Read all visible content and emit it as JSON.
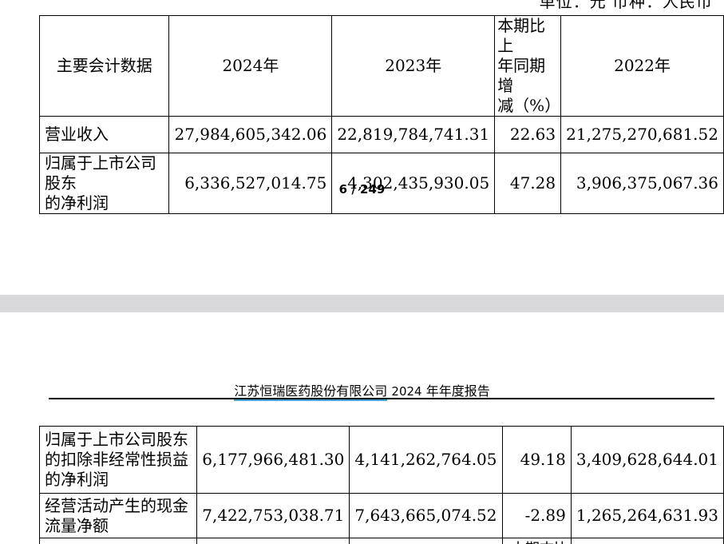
{
  "unit_line": "单位：元  币种：人民币",
  "page_number": "6 / 249",
  "report_header": {
    "company": "江苏恒瑞医药股份有限公司",
    "year": "2024",
    "title": "年年度报告"
  },
  "table": {
    "headers": [
      "主要会计数据",
      "2024年",
      "2023年",
      "本期比上年同期增减（%）",
      "2022年"
    ],
    "header_change_lines": [
      "本期比上",
      "年同期增",
      "减（%）"
    ],
    "rows_top": [
      {
        "label_lines": [
          "营业收入"
        ],
        "v2024": "27,984,605,342.06",
        "v2023": "22,819,784,741.31",
        "change": "22.63",
        "v2022": "21,275,270,681.52"
      },
      {
        "label_lines": [
          "归属于上市公司股东",
          "的净利润"
        ],
        "v2024": "6,336,527,014.75",
        "v2023": "4,302,435,930.05",
        "change": "47.28",
        "v2022": "3,906,375,067.36"
      }
    ],
    "rows_bottom": [
      {
        "label_lines": [
          "归属于上市公司股东",
          "的扣除非经常性损益",
          "的净利润"
        ],
        "v2024": "6,177,966,481.30",
        "v2023": "4,141,262,764.05",
        "change": "49.18",
        "v2022": "3,409,628,644.01"
      },
      {
        "label_lines": [
          "经营活动产生的现金",
          "流量净额"
        ],
        "v2024": "7,422,753,038.71",
        "v2023": "7,643,665,074.52",
        "change": "-2.89",
        "v2022": "1,265,264,631.93"
      }
    ],
    "cut_off_text": "本期末比"
  }
}
